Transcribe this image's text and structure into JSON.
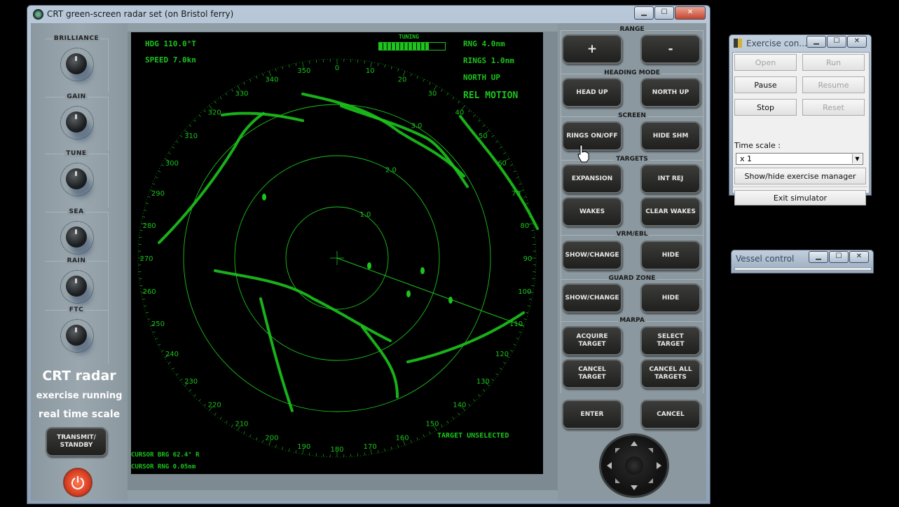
{
  "main_window": {
    "title": "CRT green-screen radar set (on Bristol ferry)",
    "btn_minimize": "▁",
    "btn_maximize": "☐",
    "btn_close": "✕"
  },
  "knobs": [
    {
      "label": "BRILLIANCE"
    },
    {
      "label": "GAIN"
    },
    {
      "label": "TUNE"
    },
    {
      "label": "SEA"
    },
    {
      "label": "RAIN"
    },
    {
      "label": "FTC"
    }
  ],
  "status": {
    "title": "CRT radar",
    "line1": "exercise running",
    "line2": "real time scale"
  },
  "transmit_button": {
    "line1": "TRANSMIT/",
    "line2": "STANDBY"
  },
  "radar": {
    "heading": "HDG 110.0°T",
    "speed": "SPEED   7.0kn",
    "tuning_label": "TUNING",
    "tuning_level": 0.75,
    "range": "RNG 4.0nm",
    "rings": "RINGS 1.0nm",
    "orientation": "NORTH UP",
    "motion": "REL MOTION",
    "target_status": "TARGET UNSELECTED",
    "cursor_brg": "CURSOR BRG  62.4° R",
    "cursor_rng": "CURSOR RNG  0.05nm",
    "ring_labels": [
      "1.0",
      "2.0",
      "3.0"
    ],
    "bearing_labels": [
      "0",
      "10",
      "20",
      "30",
      "40",
      "50",
      "60",
      "70",
      "80",
      "90",
      "100",
      "110",
      "120",
      "130",
      "140",
      "150",
      "160",
      "170",
      "180",
      "190",
      "200",
      "210",
      "220",
      "230",
      "240",
      "250",
      "260",
      "270",
      "280",
      "290",
      "300",
      "310",
      "320",
      "330",
      "340",
      "350"
    ],
    "heading_line_bearing": 110,
    "color": "#1cc41c"
  },
  "controls": {
    "range": {
      "title": "RANGE",
      "plus": "+",
      "minus": "-"
    },
    "heading_mode": {
      "title": "HEADING MODE",
      "head_up": "HEAD UP",
      "north_up": "NORTH UP"
    },
    "screen": {
      "title": "SCREEN",
      "rings": "RINGS ON/OFF",
      "hide_shm": "HIDE SHM"
    },
    "targets": {
      "title": "TARGETS",
      "expansion": "EXPANSION",
      "int_rej": "INT REJ",
      "wakes": "WAKES",
      "clear_wakes": "CLEAR WAKES"
    },
    "vrm_ebl": {
      "title": "VRM/EBL",
      "show_change": "SHOW/CHANGE",
      "hide": "HIDE"
    },
    "guard_zone": {
      "title": "GUARD ZONE",
      "show_change": "SHOW/CHANGE",
      "hide": "HIDE"
    },
    "marpa": {
      "title": "MARPA",
      "acquire_1": "ACQUIRE",
      "acquire_2": "TARGET",
      "select_1": "SELECT",
      "select_2": "TARGET",
      "cancel_1": "CANCEL",
      "cancel_2": "TARGET",
      "cancel_all_1": "CANCEL ALL",
      "cancel_all_2": "TARGETS"
    },
    "enter": "ENTER",
    "cancel": "CANCEL"
  },
  "exercise_window": {
    "title": "Exercise con...",
    "open": "Open",
    "run": "Run",
    "pause": "Pause",
    "resume": "Resume",
    "stop": "Stop",
    "reset": "Reset",
    "time_scale_label": "Time scale :",
    "time_scale_value": "x 1",
    "show_hide": "Show/hide exercise manager",
    "exit": "Exit simulator"
  },
  "vessel_window": {
    "title": "Vessel control"
  }
}
